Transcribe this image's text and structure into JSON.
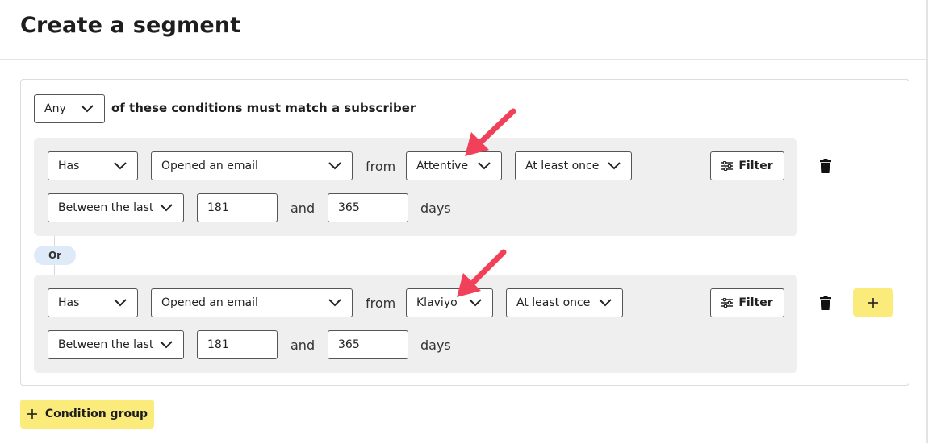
{
  "header": {
    "title": "Create a segment"
  },
  "match": {
    "quantifier": "Any",
    "label": "of these conditions must match a subscriber"
  },
  "groups": [
    {
      "row1": {
        "has": "Has",
        "event": "Opened an email",
        "from_label": "from",
        "source": "Attentive",
        "frequency": "At least once",
        "filter_label": "Filter"
      },
      "row2": {
        "range": "Between the last",
        "start": "181",
        "and_label": "and",
        "end": "365",
        "unit": "days"
      }
    },
    {
      "row1": {
        "has": "Has",
        "event": "Opened an email",
        "from_label": "from",
        "source": "Klaviyo",
        "frequency": "At least once",
        "filter_label": "Filter"
      },
      "row2": {
        "range": "Between the last",
        "start": "181",
        "and_label": "and",
        "end": "365",
        "unit": "days"
      }
    }
  ],
  "or_label": "Or",
  "condition_group_label": "Condition group",
  "colors": {
    "accent_yellow": "#fbeb7b",
    "annotation_arrow": "#f0405a",
    "or_badge": "#dfeaf8",
    "group_bg": "#efefef"
  },
  "icons": [
    "chevron-down-icon",
    "filter-sliders-icon",
    "trash-icon",
    "plus-icon",
    "annotation-arrow-icon"
  ]
}
